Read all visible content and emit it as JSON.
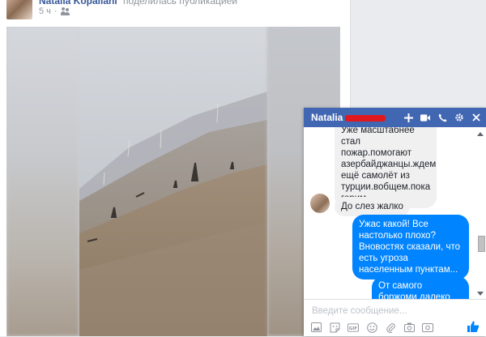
{
  "post": {
    "author": "Natalia Kopaliani",
    "shared_text": "поделилась публикацией",
    "time": "5 ч",
    "privacy_icon": "friends-icon"
  },
  "chat": {
    "title": "Natalia",
    "header_icons": [
      "plus-icon",
      "video-call-icon",
      "phone-icon",
      "gear-icon",
      "close-icon"
    ],
    "messages": [
      {
        "dir": "in",
        "text": "Уже масштабнее стал пожар.помогают азербайджанцы.ждем ещё самолёт из турции.вобщем.пока горим"
      },
      {
        "dir": "in",
        "text": "До слез жалко"
      },
      {
        "dir": "out",
        "text": "Ужас какой! Все настолько плохо? Вновостях сказали, что есть угроза населенным пунктам..."
      },
      {
        "dir": "out",
        "text": "От самого боржоми далеко горит?"
      }
    ],
    "composer": {
      "placeholder": "Введите сообщение...",
      "tools": [
        "photo-icon",
        "sticker-icon",
        "gif-icon",
        "emoji-icon",
        "attachment-icon",
        "camera-icon",
        "money-icon"
      ],
      "like_icon": "thumbs-up-icon"
    },
    "accent": "#4267b2",
    "bubble_out_color": "#0084ff"
  }
}
